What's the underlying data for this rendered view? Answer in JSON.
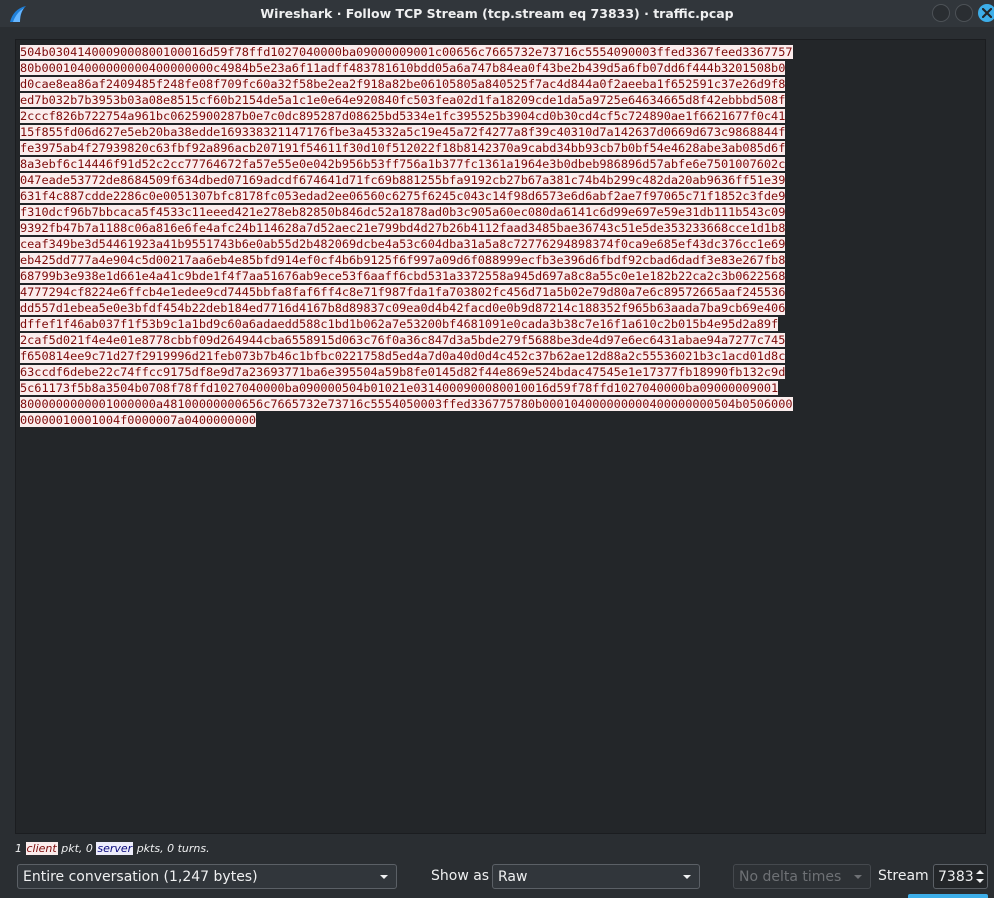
{
  "window": {
    "title": "Wireshark · Follow TCP Stream (tcp.stream eq 73833) · traffic.pcap"
  },
  "stream": {
    "lines": [
      "504b0304140009000800100016d59f78ffd1027040000ba09000009001c00656c7665732e73716c5554090003ffed3367feed3367757",
      "80b000104000000000400000000c4984b5e23a6f11adff483781610bdd05a6a747b84ea0f43be2b439d5a6fb07dd6f444b3201508b0",
      "d0cae8ea86af2409485f248fe08f709fc60a32f58be2ea2f918a82be06105805a840525f7ac4d844a0f2aeeba1f652591c37e26d9f8",
      "ed7b032b7b3953b03a08e8515cf60b2154de5a1c1e0e64e920840fc503fea02d1fa18209cde1da5a9725e64634665d8f42ebbbd508f",
      "2cccf826b722754a961bc0625900287b0e7c0dc895287d08625bd5334e1fc395525b3904cd0b30cd4cf5c724890ae1f6621677f0c41",
      "15f855fd06d627e5eb20ba38edde169338321147176fbe3a45332a5c19e45a72f4277a8f39c40310d7a142637d0669d673c9868844f",
      "fe3975ab4f27939820c63fbf92a896acb207191f54611f30d10f512022f18b8142370a9cabd34bb93cb7b0bf54e4628abe3ab085d6f",
      "8a3ebf6c14446f91d52c2cc77764672fa57e55e0e042b956b53ff756a1b377fc1361a1964e3b0dbeb986896d57abfe6e7501007602c",
      "047eade53772de8684509f634dbed07169adcdf674641d71fc69b881255bfa9192cb27b67a381c74b4b299c482da20ab9636ff51e39",
      "631f4c887cdde2286c0e0051307bfc8178fc053edad2ee06560c6275f6245c043c14f98d6573e6d6abf2ae7f97065c71f1852c3fde9",
      "f310dcf96b7bbcaca5f4533c11eeed421e278eb82850b846dc52a1878ad0b3c905a60ec080da6141c6d99e697e59e31db111b543c09",
      "9392fb47b7a1188c06a816e6fe4afc24b114628a7d52aec21e799bd4d27b26b4112faad3485bae36743c51e5de353233668cce1d1b8",
      "ceaf349be3d54461923a41b9551743b6e0ab55d2b482069dcbe4a53c604dba31a5a8c72776294898374f0ca9e685ef43dc376cc1e69",
      "eb425dd777a4e904c5d00217aa6eb4e85bfd914ef0cf4b6b9125f6f997a09d6f088999ecfb3e396d6fbdf92cbad6dadf3e83e267fb8",
      "68799b3e938e1d661e4a41c9bde1f4f7aa51676ab9ece53f6aaff6cbd531a3372558a945d697a8c8a55c0e1e182b22ca2c3b0622568",
      "4777294cf8224e6ffcb4e1edee9cd7445bbfa8faf6ff4c8e71f987fda1fa703802fc456d71a5b02e79d80a7e6c89572665aaf245536",
      "dd557d1ebea5e0e3bfdf454b22deb184ed7716d4167b8d89837c09ea0d4b42facd0e0b9d87214c188352f965b63aada7ba9cb69e406",
      "dffef1f46ab037f1f53b9c1a1bd9c60a6adaedd588c1bd1b062a7e53200bf4681091e0cada3b38c7e16f1a610c2b015b4e95d2a89f",
      "2caf5d021f4e4e01e8778cbbf09d264944cba6558915d063c76f0a36c847d3a5bde279f5688be3de4d97e6ec6431abae94a7277c745",
      "f650814ee9c71d27f2919996d21feb073b7b46c1bfbc0221758d5ed4a7d0a40d0d4c452c37b62ae12d88a2c55536021b3c1acd01d8c",
      "63ccdf6debe22c74ffcc9175df8e9d7a23693771ba6e395504a59b8fe0145d82f44e869e524bdac47545e1e17377fb18990fb132c9d",
      "5c61173f5b8a3504b0708f78ffd1027040000ba090000504b01021e0314000900080010016d59f78ffd1027040000ba09000009001",
      "8000000000001000000a48100000000656c7665732e73716c5554050003ffed336775780b000104000000000400000000504b0506000",
      "00000010001004f0000007a0400000000"
    ]
  },
  "stats": {
    "prefix": "1 ",
    "client_label": "client",
    "middle": " pkt, 0 ",
    "server_label": "server",
    "suffix": " pkts, 0 turns."
  },
  "controls": {
    "conversation_select": "Entire conversation (1,247 bytes)",
    "show_as_label": "Show as",
    "show_as_value": "Raw",
    "delta_select": "No delta times",
    "stream_label": "Stream",
    "stream_value": "7383"
  },
  "colors": {
    "client_fg": "#7d0a0a",
    "client_bg": "#fbeded",
    "server_fg": "#0a0a7d",
    "server_bg": "#ededfb",
    "accent": "#3daee9"
  }
}
